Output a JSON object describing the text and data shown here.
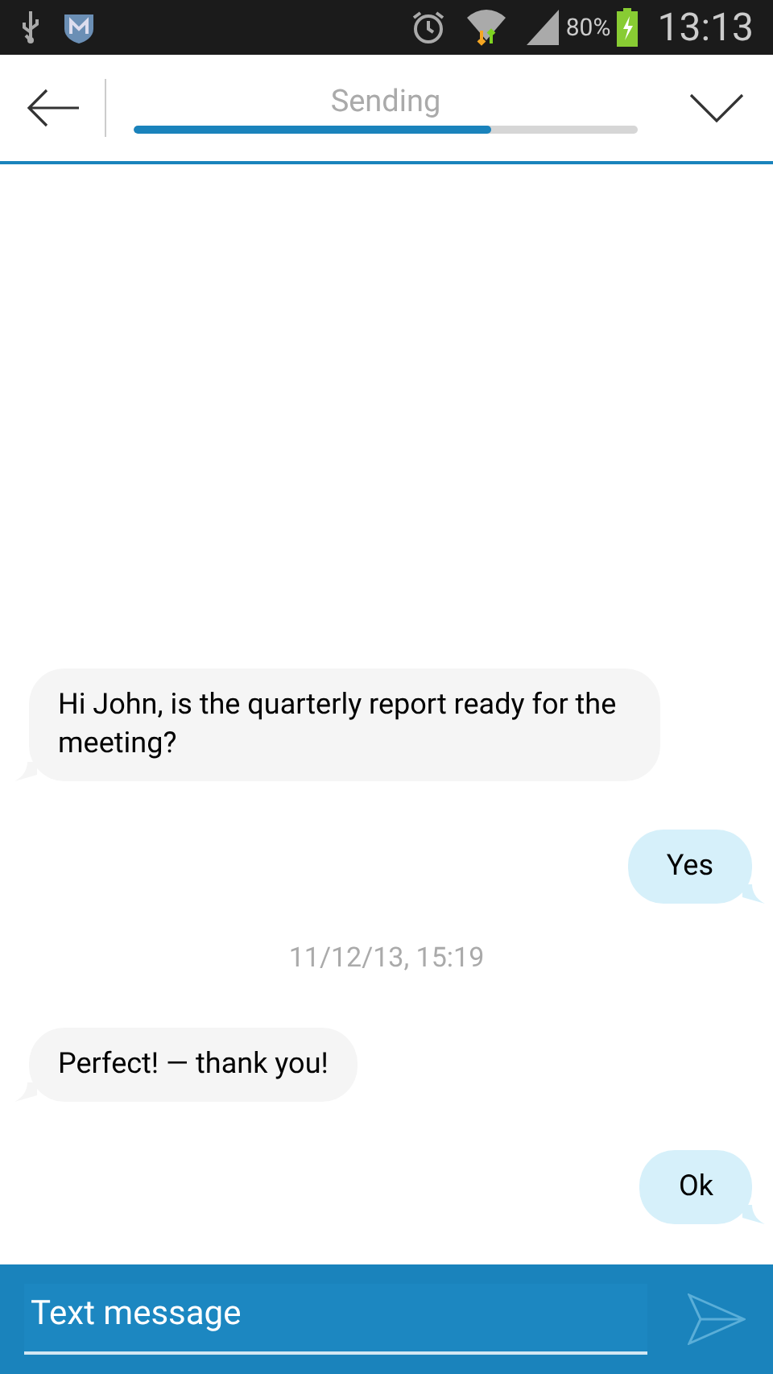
{
  "status_bar": {
    "battery": "80%",
    "time": "13:13"
  },
  "header": {
    "title": "Sending",
    "level": 0.71
  },
  "messages": [
    {
      "kind": "incoming",
      "text": "Hi John, is the quarterly report ready for the meeting?"
    },
    {
      "kind": "outgoing",
      "text": "Yes"
    },
    {
      "kind": "timestamp",
      "text": "11/12/13, 15:19"
    },
    {
      "kind": "incoming",
      "text": "Perfect! — thank you!"
    },
    {
      "kind": "outgoing",
      "text": "Ok"
    }
  ],
  "composer": {
    "placeholder": "Text message"
  }
}
